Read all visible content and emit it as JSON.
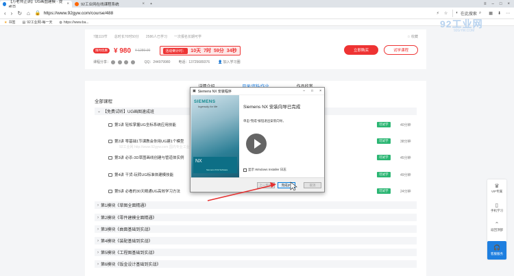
{
  "browser": {
    "tabs": [
      {
        "label": "【万老师正讲】UG画图建模 - 提成百...",
        "active": true
      },
      {
        "label": "92工业网在线课程系统",
        "active": false
      }
    ],
    "url": "https://www.92gyw.com/course/488",
    "search_label": "在此搜索",
    "bookmarks": [
      "书签",
      "92工业网-每一天",
      "https://www.ba..."
    ]
  },
  "logo": {
    "text": "92工业网",
    "sub": "92GYW.COM"
  },
  "course": {
    "stats": [
      "7篇119节",
      "总时长70时50分",
      "2586人已学习",
      "一次报名长期可学"
    ],
    "favorite": "☆ 收藏",
    "tag": "限时优惠",
    "price": "¥ 980",
    "old_price": "¥ 1280.00",
    "countdown_label": "活动倒计时：",
    "countdown": [
      "10天",
      "7时",
      "59分",
      "34秒"
    ],
    "buy_label": "立即购买",
    "try_label": "试学课程",
    "share_label": "课程分享：",
    "qq": "QQ：244979980",
    "phone": "电话：13725689376",
    "add_label": "加入学习圈"
  },
  "content_tabs": [
    "详情介绍",
    "目录/资料/作业",
    "作品欣赏"
  ],
  "catalog": {
    "title": "全部课程",
    "modules": [
      "【免费试听】UG画图速成班",
      "第1模块《草图全面精通》",
      "第2模块《零件建模全面精通》",
      "第3模块《曲面基础到实战》",
      "第4模块《装配基础到实战》",
      "第5模块《工程图基础到实战》",
      "第6模块《钣金设计基础到实战》"
    ],
    "lessons": [
      {
        "title": "第1讲 轻松掌握UG坐标系统应用技能",
        "free": "可试学",
        "dur": "40分钟"
      },
      {
        "title": "第2讲 零基础1节课教会你用UG建1个模型",
        "free": "可试学",
        "dur": "38分钟"
      },
      {
        "title": "第3讲 必杀-3D草图画线创建与管道体实例",
        "free": "可试学",
        "dur": "45分钟"
      },
      {
        "title": "第4讲 干货-玩转UG标准体建模技能",
        "free": "可试学",
        "dur": "49分钟"
      },
      {
        "title": "第5讲 必看的30天精通UG高效学习方法",
        "free": "可试学",
        "dur": "24分钟"
      }
    ],
    "watermark": "92工业网 http://www.92gyw.com 国内专业工业设计学习平台"
  },
  "sidebar": {
    "items": [
      "VIP专属",
      "手机学习",
      "返回顶部"
    ],
    "service": "客服服务"
  },
  "dialog": {
    "title": "Siemens NX 安装程序",
    "heading": "Siemens NX 安装向导已完成",
    "body": "单击\"完成\"按钮退出安装向导。",
    "brand": "SIEMENS",
    "tagline": "Ingenuity for life",
    "product": "NX",
    "product_sub": "Siemens PLM Software",
    "checkbox_label": "显示 Windows Installer 日志",
    "back_label": "上一步(B)",
    "finish_label": "完成(F)",
    "cancel_label": "取消"
  }
}
